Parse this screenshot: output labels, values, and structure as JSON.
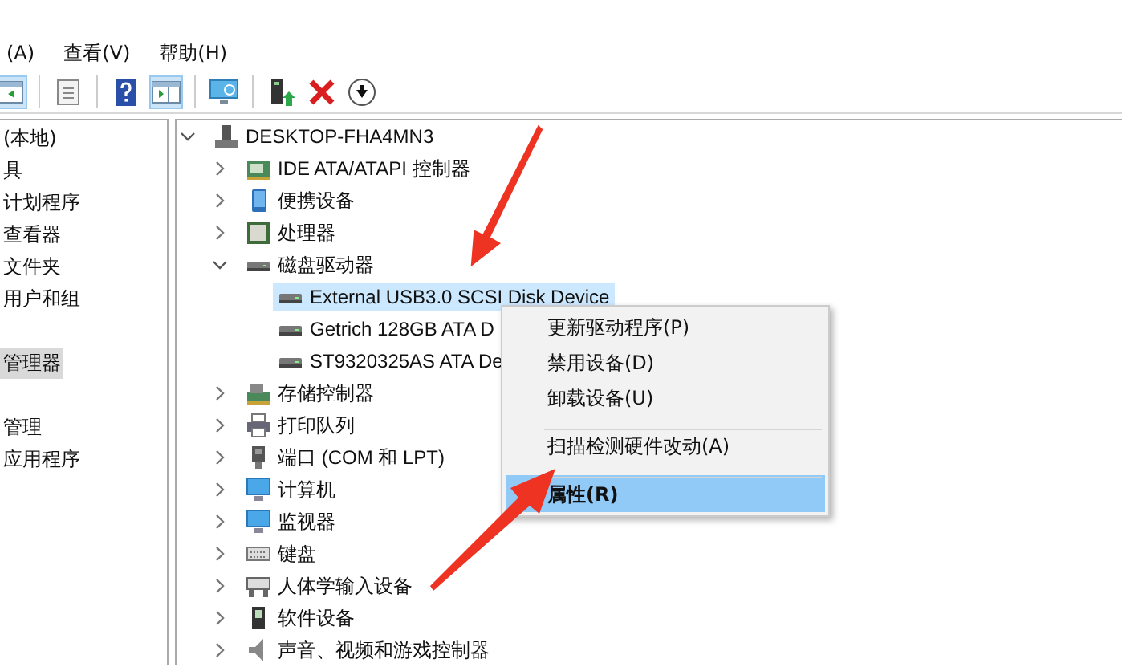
{
  "menu_bar": [
    {
      "label": "(A)"
    },
    {
      "label": "查看(V)"
    },
    {
      "label": "帮助(H)"
    }
  ],
  "toolbar": [
    {
      "kind": "back",
      "pressed": true
    },
    {
      "kind": "properties",
      "pressed": false
    },
    {
      "kind": "help",
      "pressed": false
    },
    {
      "kind": "panel",
      "pressed": true
    },
    {
      "kind": "scan",
      "pressed": false
    },
    {
      "kind": "update",
      "pressed": false
    },
    {
      "kind": "uninstall",
      "pressed": false
    },
    {
      "kind": "disable",
      "pressed": false
    }
  ],
  "sidebar": {
    "items": [
      {
        "label": "(本地)",
        "selected": false
      },
      {
        "label": "具",
        "selected": false
      },
      {
        "label": "计划程序",
        "selected": false
      },
      {
        "label": "查看器",
        "selected": false
      },
      {
        "label": "文件夹",
        "selected": false
      },
      {
        "label": "用户和组",
        "selected": false
      },
      {
        "label": "管理器",
        "selected": true
      },
      {
        "label": "管理",
        "selected": false
      },
      {
        "label": "应用程序",
        "selected": false
      }
    ]
  },
  "tree": [
    {
      "label": "DESKTOP-FHA4MN3",
      "kind": "computer",
      "expanded": true,
      "selected": false,
      "children": [
        {
          "label": "IDE ATA/ATAPI 控制器",
          "kind": "ide",
          "expanded": false,
          "selected": false
        },
        {
          "label": "便携设备",
          "kind": "portable",
          "expanded": false,
          "selected": false
        },
        {
          "label": "处理器",
          "kind": "cpu",
          "expanded": false,
          "selected": false
        },
        {
          "label": "磁盘驱动器",
          "kind": "disk",
          "expanded": true,
          "selected": false,
          "children": [
            {
              "label": "External USB3.0 SCSI Disk Device",
              "kind": "disk",
              "selected": true
            },
            {
              "label": "Getrich 128GB ATA D",
              "kind": "disk",
              "selected": false
            },
            {
              "label": "ST9320325AS ATA De",
              "kind": "disk",
              "selected": false
            }
          ]
        },
        {
          "label": "存储控制器",
          "kind": "storage",
          "expanded": false,
          "selected": false
        },
        {
          "label": "打印队列",
          "kind": "printer",
          "expanded": false,
          "selected": false
        },
        {
          "label": "端口 (COM 和 LPT)",
          "kind": "port",
          "expanded": false,
          "selected": false
        },
        {
          "label": "计算机",
          "kind": "monitor",
          "expanded": false,
          "selected": false
        },
        {
          "label": "监视器",
          "kind": "monitor",
          "expanded": false,
          "selected": false
        },
        {
          "label": "键盘",
          "kind": "keyboard",
          "expanded": false,
          "selected": false
        },
        {
          "label": "人体学输入设备",
          "kind": "hid",
          "expanded": false,
          "selected": false
        },
        {
          "label": "软件设备",
          "kind": "software",
          "expanded": false,
          "selected": false
        },
        {
          "label": "声音、视频和游戏控制器",
          "kind": "sound",
          "expanded": false,
          "selected": false
        }
      ]
    }
  ],
  "context_menu": [
    {
      "label": "更新驱动程序(P)",
      "selected": false,
      "separator_before": false
    },
    {
      "label": "禁用设备(D)",
      "selected": false,
      "separator_before": false
    },
    {
      "label": "卸载设备(U)",
      "selected": false,
      "separator_before": false
    },
    {
      "label": "扫描检测硬件改动(A)",
      "selected": false,
      "separator_before": true
    },
    {
      "label": "属性(R)",
      "selected": true,
      "separator_before": true
    }
  ]
}
